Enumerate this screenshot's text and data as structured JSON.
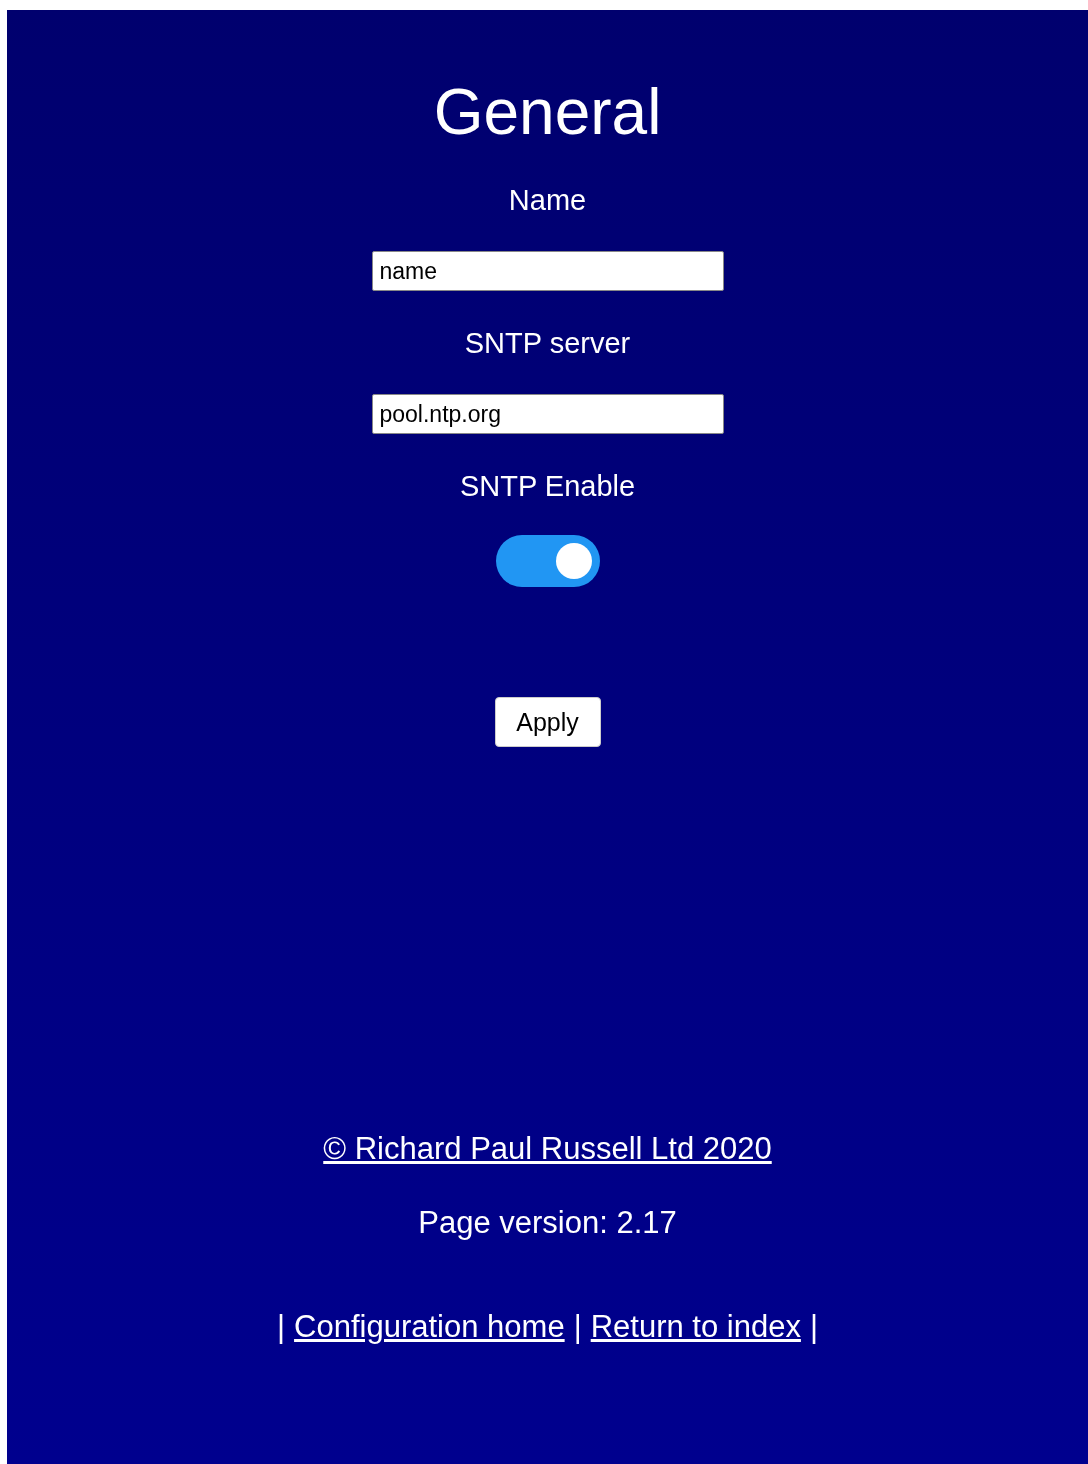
{
  "title": "General",
  "fields": [
    {
      "label": "Name",
      "value": "name"
    },
    {
      "label": "SNTP server",
      "value": "pool.ntp.org"
    }
  ],
  "toggle": {
    "label": "SNTP Enable",
    "on": true
  },
  "apply_button": "Apply",
  "copyright": "© Richard Paul Russell Ltd 2020",
  "page_version": "Page version: 2.17",
  "nav": [
    {
      "kind": "separator",
      "text": "|"
    },
    {
      "kind": "link",
      "text": "Configuration home"
    },
    {
      "kind": "separator",
      "text": "|"
    },
    {
      "kind": "link",
      "text": "Return to index"
    },
    {
      "kind": "separator",
      "text": "|"
    }
  ]
}
